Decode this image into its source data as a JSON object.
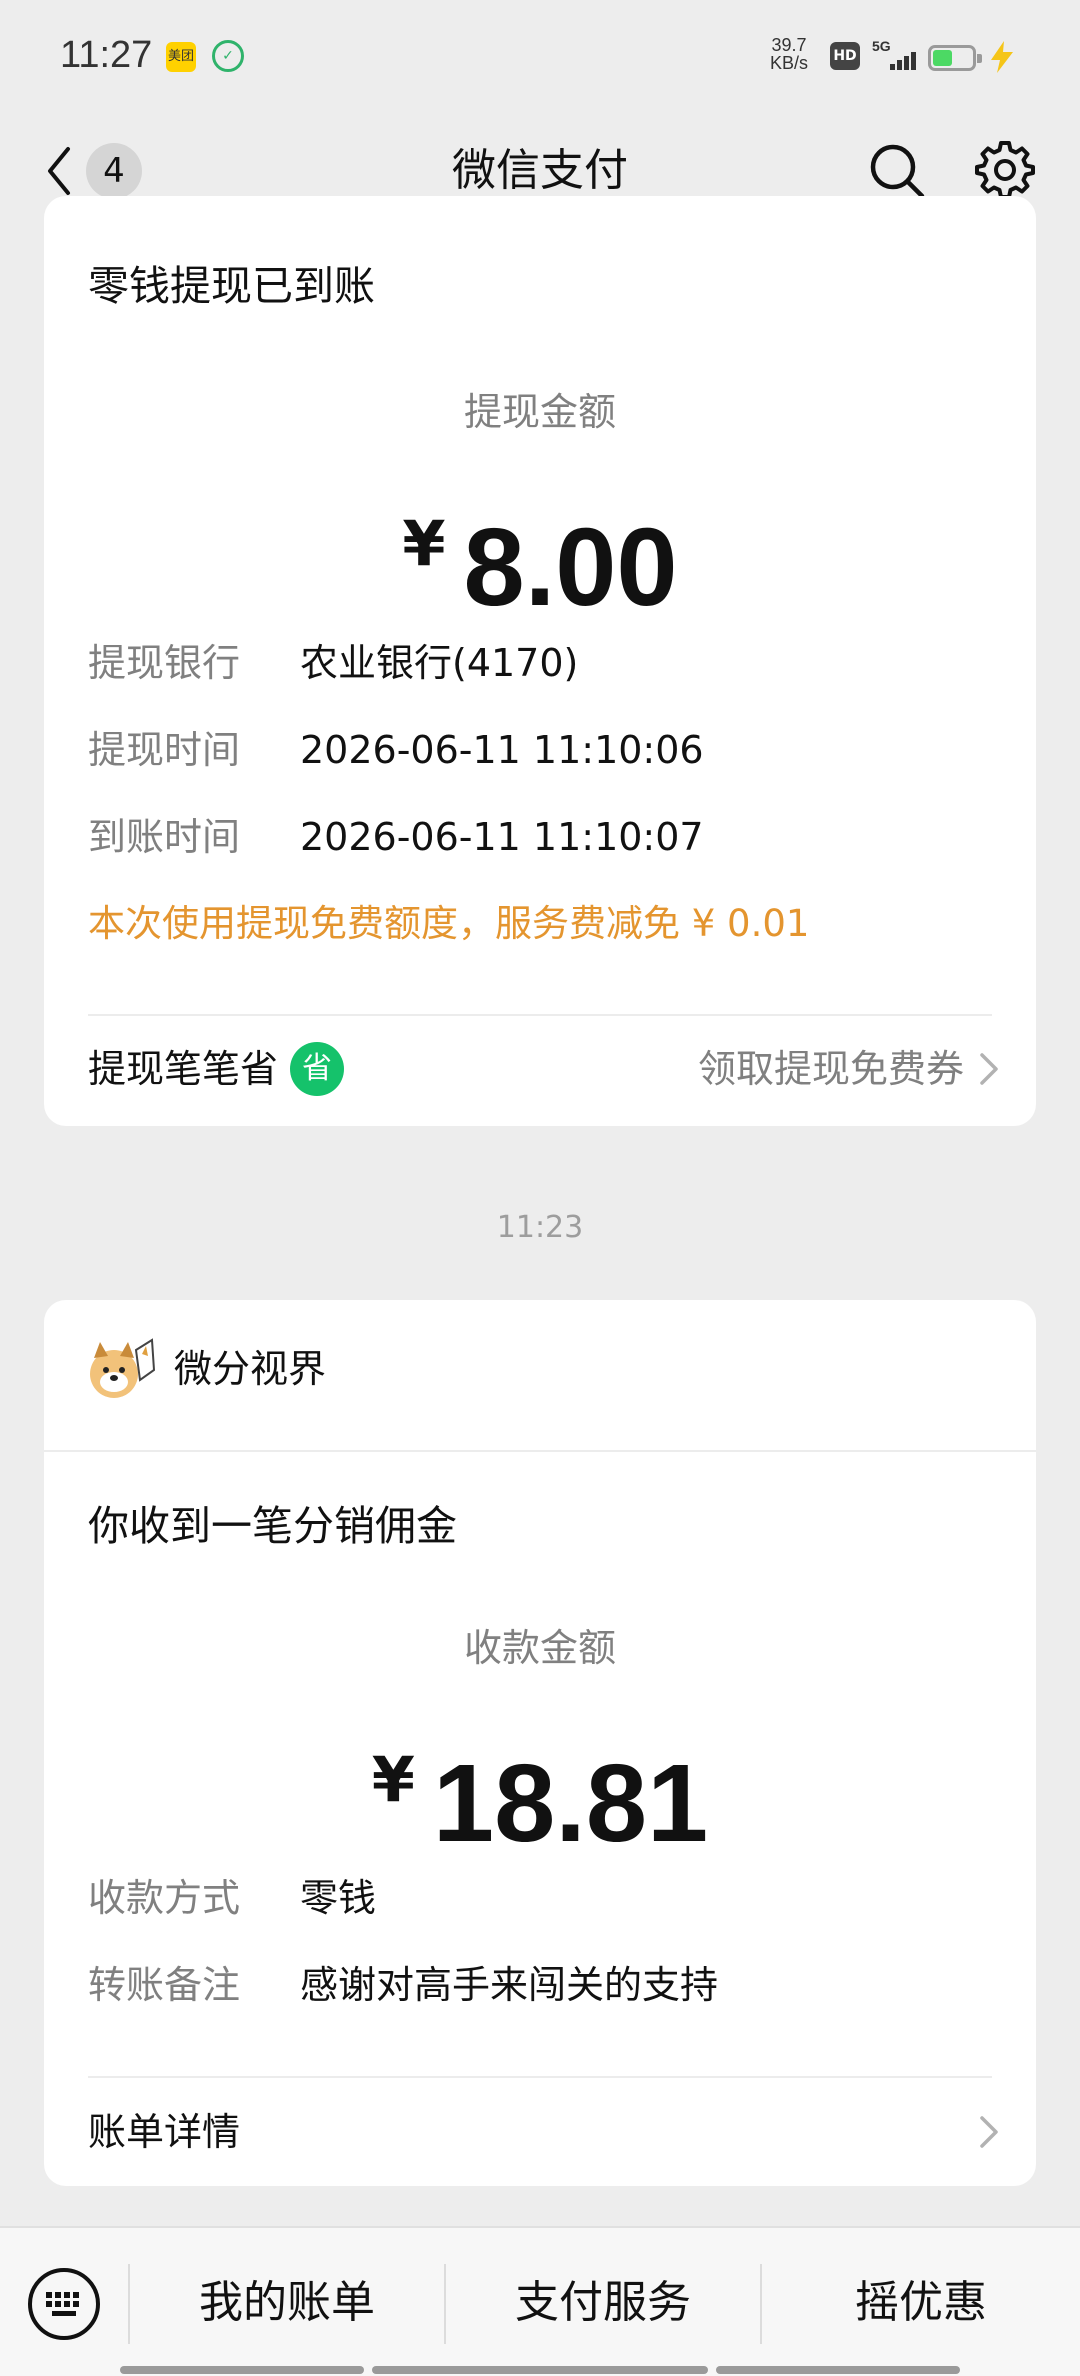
{
  "status_bar": {
    "time": "11:27",
    "app_icon_1": "美团",
    "speed_value": "39.7",
    "speed_unit": "KB/s",
    "hd": "HD",
    "network": "5G",
    "battery_level": 0.5
  },
  "nav": {
    "unread_count": "4",
    "title": "微信支付"
  },
  "withdraw_card": {
    "title": "零钱提现已到账",
    "amount_label": "提现金额",
    "currency": "¥",
    "amount": "8.00",
    "rows": [
      {
        "key": "提现银行",
        "value": "农业银行(4170)"
      },
      {
        "key": "提现时间",
        "value": "2026-06-11 11:10:06"
      },
      {
        "key": "到账时间",
        "value": "2026-06-11 11:10:07"
      }
    ],
    "fee_note": "本次使用提现免费额度，服务费减免 ¥ 0.01",
    "footer_left": "提现笔笔省",
    "footer_badge": "省",
    "footer_right": "领取提现免费券"
  },
  "timestamp": "11:23",
  "commission_card": {
    "merchant_name": "微分视界",
    "title": "你收到一笔分销佣金",
    "amount_label": "收款金额",
    "currency": "¥",
    "amount": "18.81",
    "rows": [
      {
        "key": "收款方式",
        "value": "零钱"
      },
      {
        "key": "转账备注",
        "value": "感谢对高手来闯关的支持"
      }
    ],
    "footer_left": "账单详情"
  },
  "bottom_menu": {
    "items": [
      "我的账单",
      "支付服务",
      "摇优惠"
    ]
  },
  "colors": {
    "accent_orange": "#e4952f",
    "green_badge": "#15c26b",
    "background": "#ededed"
  }
}
